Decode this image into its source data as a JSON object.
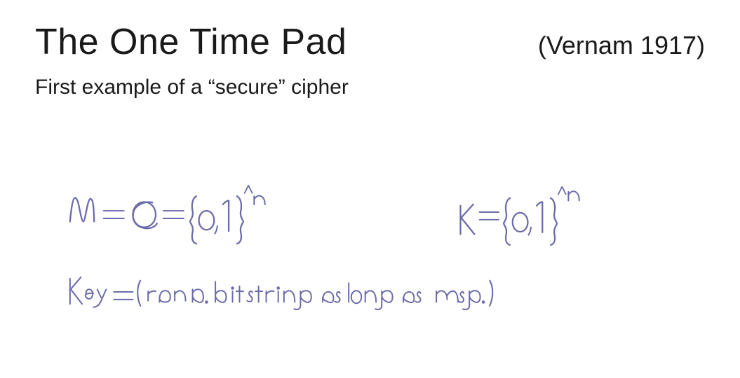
{
  "slide": {
    "title": "The One Time Pad",
    "attribution": "(Vernam 1917)",
    "subtitle": "First example of a “secure” cipher",
    "math": {
      "line1_left": "M = C = {0,1}^n",
      "line1_right": "K = {0,1}^n",
      "line2": "Key = ( rand. bit string as long as msg. )"
    },
    "colors": {
      "handwriting": "#6b6baa",
      "text": "#1a1a1a"
    }
  }
}
